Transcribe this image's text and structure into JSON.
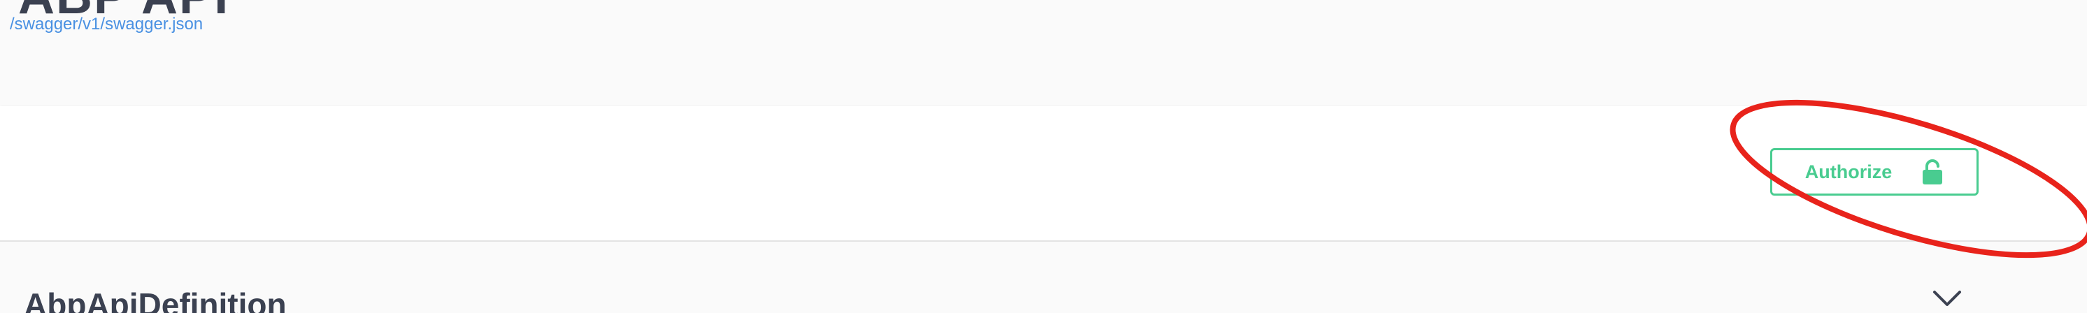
{
  "info": {
    "title_fragment": "ABP API",
    "spec_url": "/swagger/v1/swagger.json"
  },
  "scheme_container": {
    "authorize_label": "Authorize"
  },
  "tag": {
    "name": "AbpApiDefinition"
  },
  "icons": {
    "lock": "unlocked-padlock-icon",
    "chevron": "chevron-down-icon"
  },
  "colors": {
    "accent_green": "#49cc90",
    "link_blue": "#4990e2",
    "heading_dark": "#3b4151",
    "annotation_red": "#e8231b"
  }
}
